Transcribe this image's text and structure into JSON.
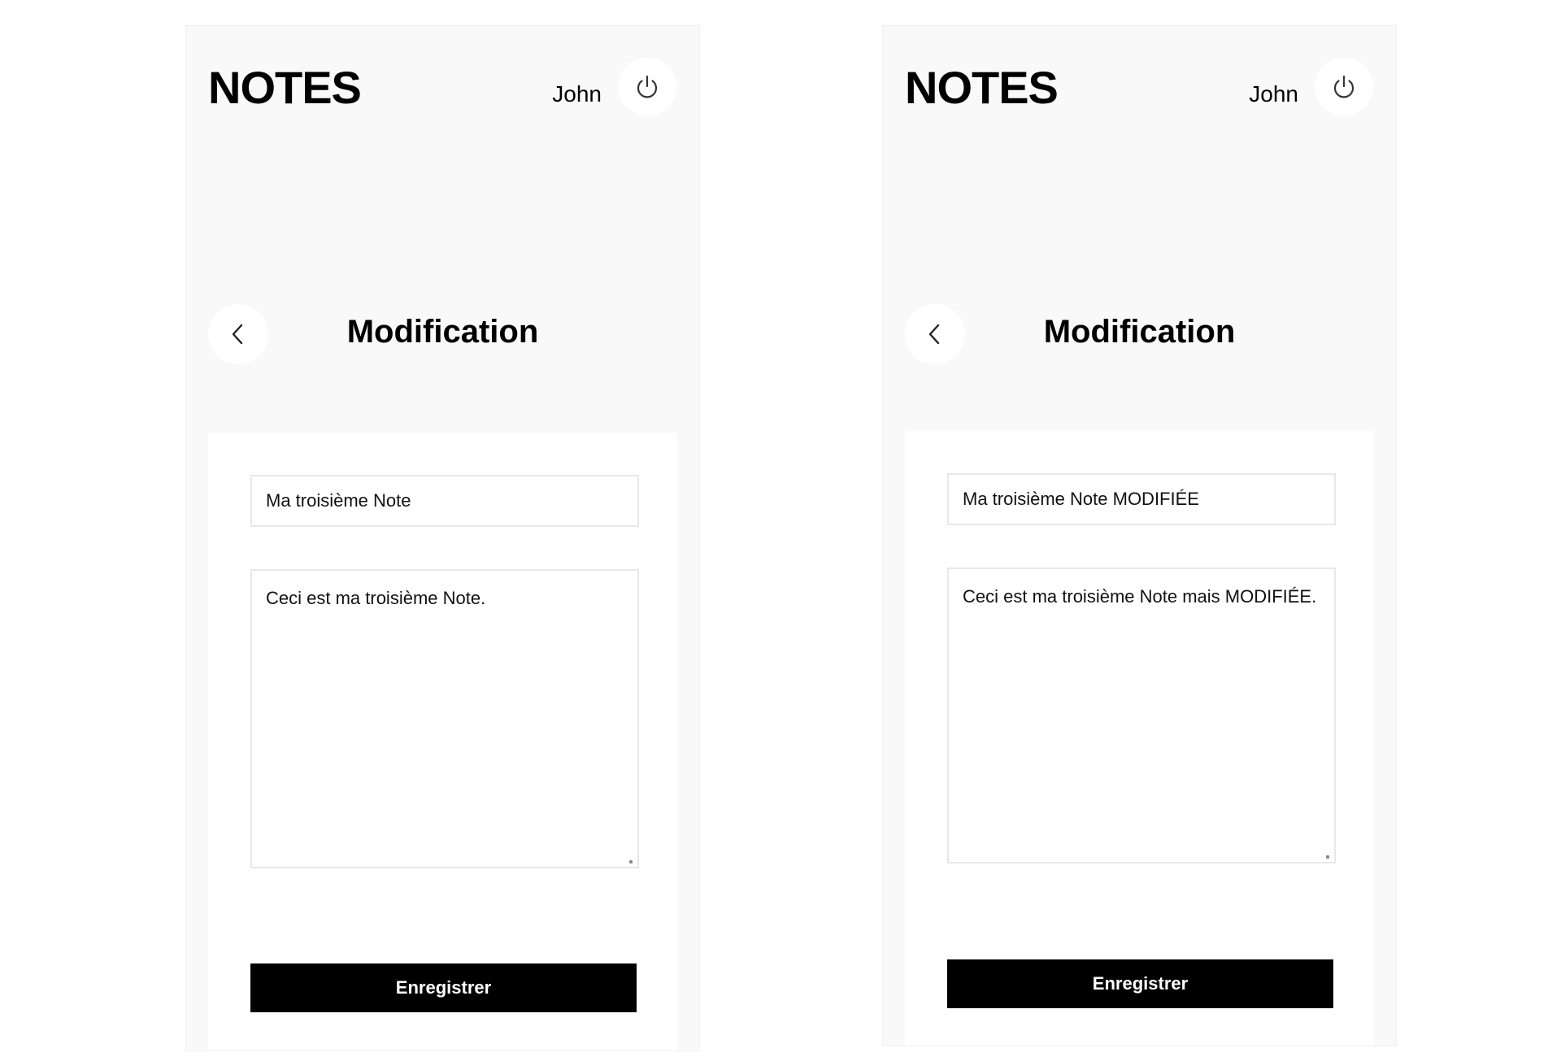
{
  "screens": [
    {
      "app_title": "NOTES",
      "user_name": "John",
      "page_title": "Modification",
      "note_title": "Ma troisième Note",
      "note_content": "Ceci est ma troisième Note.",
      "save_label": "Enregistrer"
    },
    {
      "app_title": "NOTES",
      "user_name": "John",
      "page_title": "Modification",
      "note_title": "Ma troisième Note MODIFIÉE",
      "note_content": "Ceci est ma troisième Note mais MODIFIÉE.",
      "save_label": "Enregistrer"
    }
  ],
  "icons": {
    "power": "power-icon",
    "back": "chevron-left-icon"
  }
}
